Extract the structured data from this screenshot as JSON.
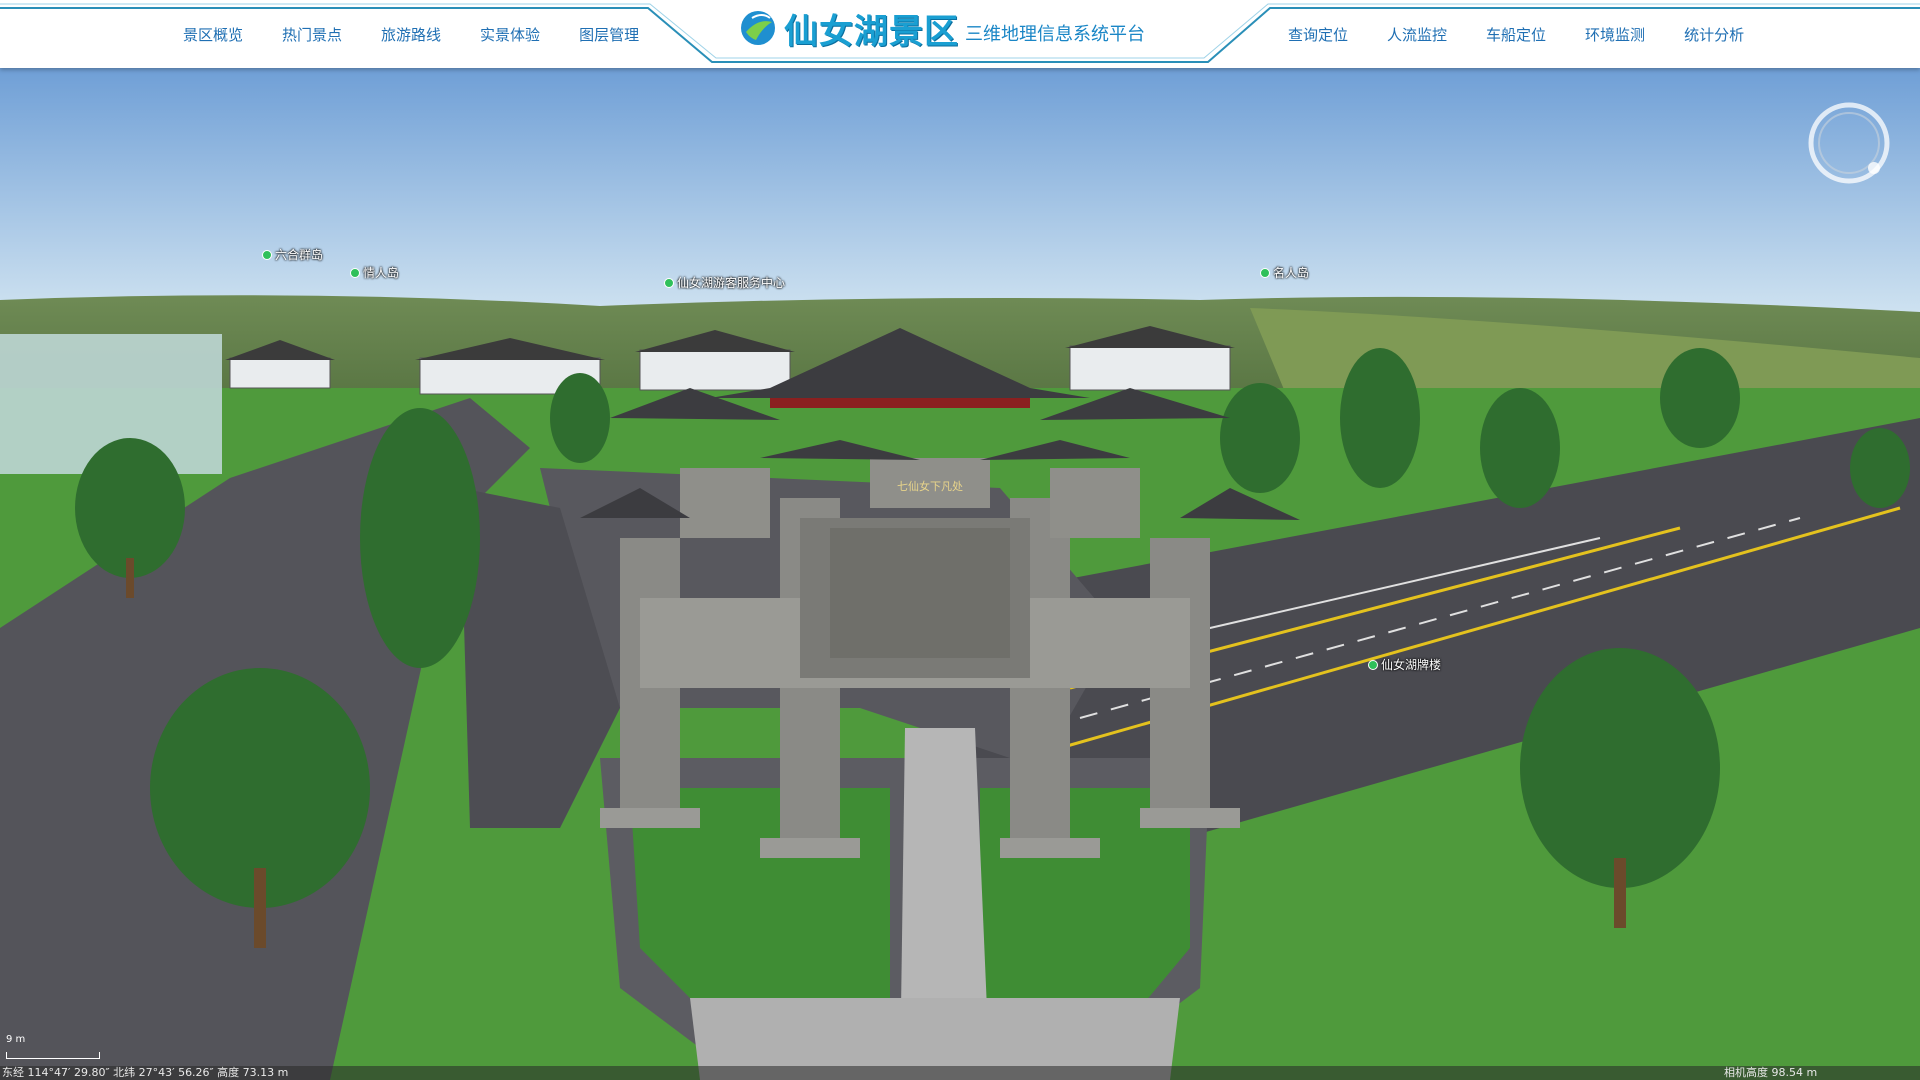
{
  "header": {
    "left_nav": [
      "景区概览",
      "热门景点",
      "旅游路线",
      "实景体验",
      "图层管理"
    ],
    "right_nav": [
      "查询定位",
      "人流监控",
      "车船定位",
      "环境监测",
      "统计分析"
    ],
    "title_main": "仙女湖景区",
    "title_sub": "三维地理信息系统平台"
  },
  "map": {
    "labels": [
      "六合群岛",
      "情人岛",
      "仙女湖游客服务中心",
      "名人岛",
      "仙女湖牌楼"
    ],
    "gate_plaque": "七仙女下凡处",
    "compass_icon": "compass-icon"
  },
  "status": {
    "scale_label": "9 m",
    "coordinates": "东经 114°47′ 29.80″   北纬 27°43′ 56.26″   高度 73.13 m",
    "camera_height": "相机高度 98.54 m"
  },
  "colors": {
    "nav_text": "#1f6fb3",
    "title": "#1a9fd2",
    "frame": "#2a8fb8",
    "poi_dot": "#2fc05a"
  }
}
